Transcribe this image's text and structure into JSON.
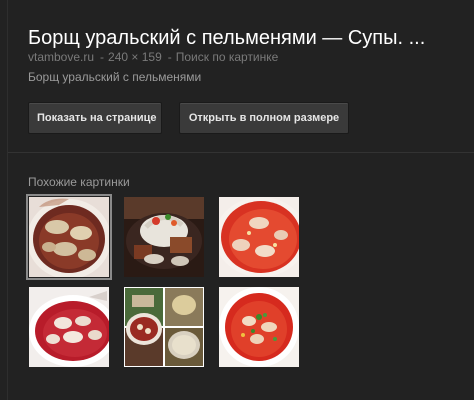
{
  "result": {
    "title": "Борщ уральский с пельменями — Супы. ...",
    "source": "vtambove.ru",
    "size": "240 × 159",
    "search_link": "Поиск по картинке",
    "description": "Борщ уральский с пельменями"
  },
  "buttons": {
    "show_on_page": "Показать на странице",
    "full_size": "Открыть в полном размере"
  },
  "similar": {
    "label": "Похожие картинки",
    "selected_index": 0
  },
  "colors": {
    "background": "#222222",
    "button": "#3a3a3a",
    "title": "#ffffff",
    "muted": "#7a7a7a"
  }
}
